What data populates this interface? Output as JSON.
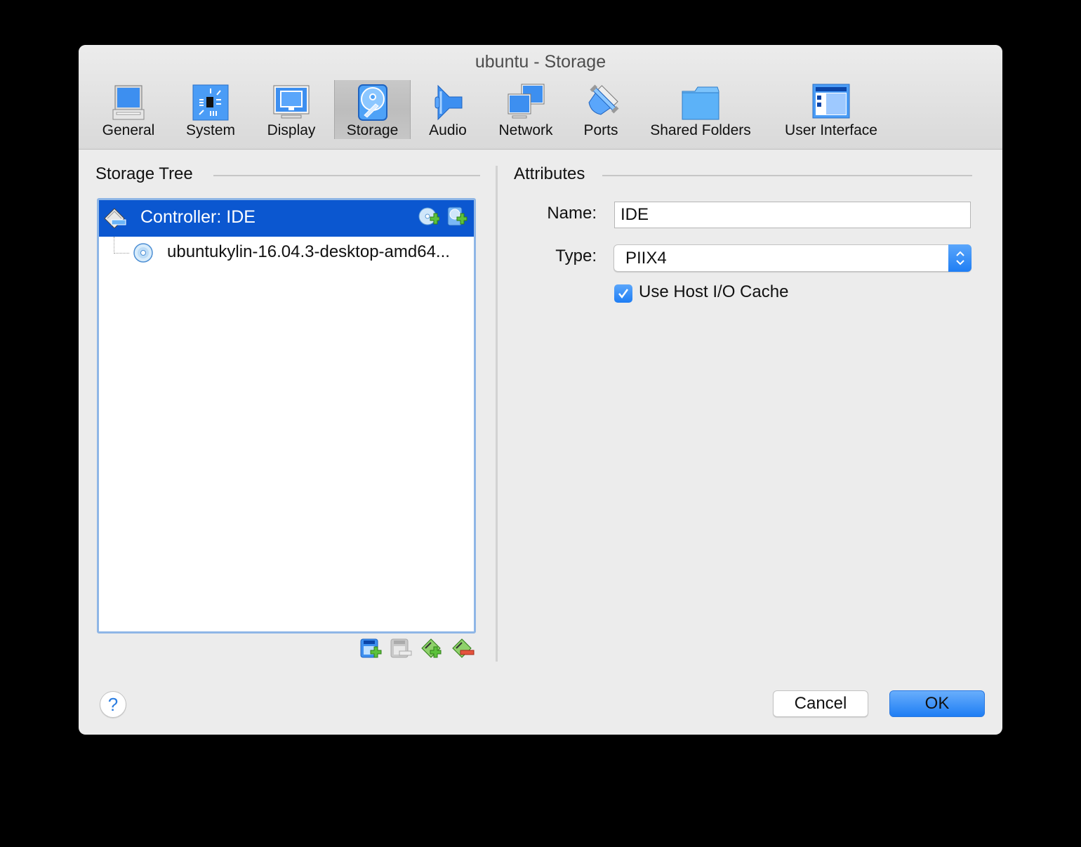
{
  "window": {
    "title": "ubuntu - Storage"
  },
  "toolbar": {
    "items": [
      {
        "label": "General",
        "icon": "general-monitor-icon",
        "selected": false
      },
      {
        "label": "System",
        "icon": "system-chip-icon",
        "selected": false
      },
      {
        "label": "Display",
        "icon": "display-monitor-icon",
        "selected": false
      },
      {
        "label": "Storage",
        "icon": "storage-harddisk-icon",
        "selected": true
      },
      {
        "label": "Audio",
        "icon": "audio-speaker-icon",
        "selected": false
      },
      {
        "label": "Network",
        "icon": "network-monitors-icon",
        "selected": false
      },
      {
        "label": "Ports",
        "icon": "ports-serial-icon",
        "selected": false
      },
      {
        "label": "Shared Folders",
        "icon": "folder-icon",
        "selected": false
      },
      {
        "label": "User Interface",
        "icon": "user-interface-window-icon",
        "selected": false
      }
    ]
  },
  "storage_tree": {
    "heading": "Storage Tree",
    "controller": {
      "label": "Controller: IDE",
      "icon": "ide-controller-icon",
      "actions": [
        "add-optical-drive-icon",
        "add-hard-disk-icon"
      ]
    },
    "attachments": [
      {
        "label": "ubuntukylin-16.04.3-desktop-amd64...",
        "icon": "optical-disc-icon"
      }
    ],
    "tools": [
      "add-controller-icon",
      "remove-controller-icon",
      "add-attachment-icon",
      "remove-attachment-icon"
    ]
  },
  "attributes": {
    "heading": "Attributes",
    "name_label": "Name:",
    "name_value": "IDE",
    "type_label": "Type:",
    "type_value": "PIIX4",
    "host_cache_label": "Use Host I/O Cache",
    "host_cache_checked": true
  },
  "buttons": {
    "help": "?",
    "cancel": "Cancel",
    "ok": "OK"
  },
  "colors": {
    "selection": "#0b57d0",
    "accent": "#1f7ef4"
  }
}
